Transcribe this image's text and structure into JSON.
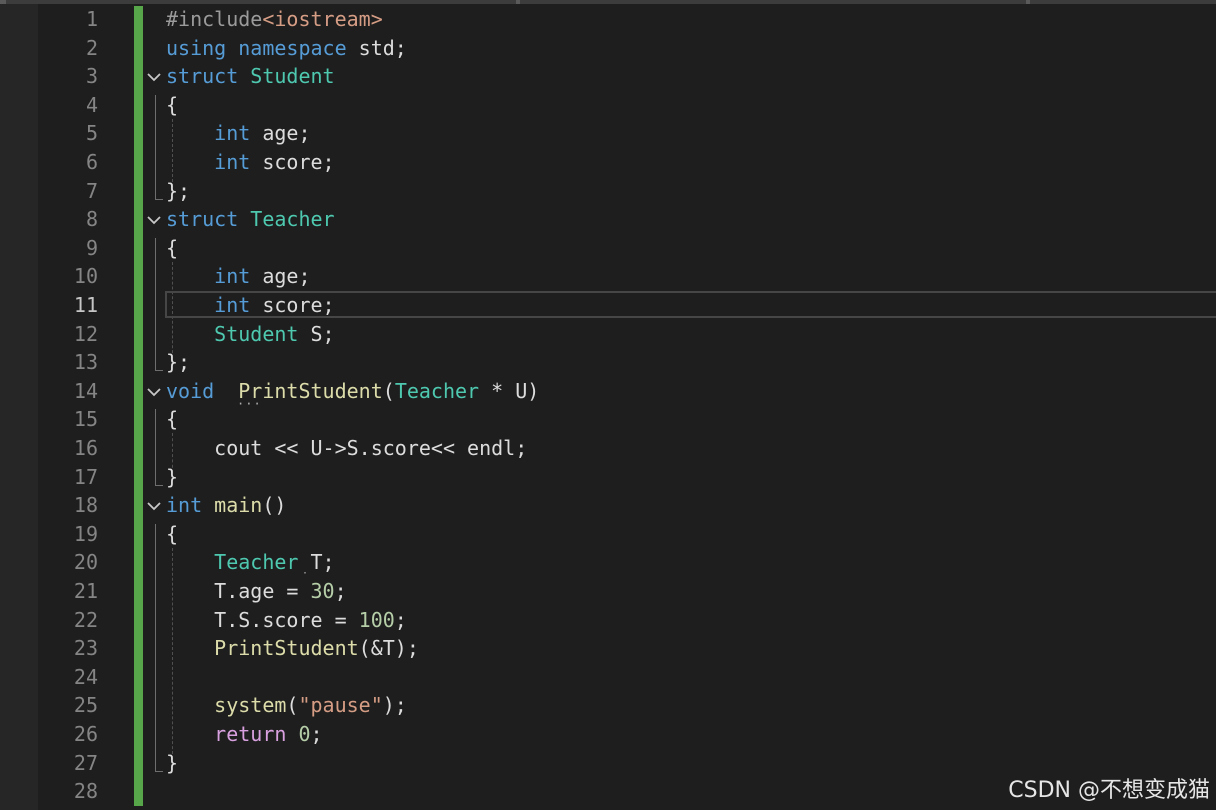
{
  "line_numbers": [
    "1",
    "2",
    "3",
    "4",
    "5",
    "6",
    "7",
    "8",
    "9",
    "10",
    "11",
    "12",
    "13",
    "14",
    "15",
    "16",
    "17",
    "18",
    "19",
    "20",
    "21",
    "22",
    "23",
    "24",
    "25",
    "26",
    "27",
    "28"
  ],
  "current_line": "11",
  "code_lines": [
    [
      {
        "t": "#include",
        "c": "pre"
      },
      {
        "t": "<iostream>",
        "c": "str"
      }
    ],
    [
      {
        "t": "using",
        "c": "kw"
      },
      {
        "t": " "
      },
      {
        "t": "namespace",
        "c": "kw"
      },
      {
        "t": " std;"
      }
    ],
    [
      {
        "t": "struct",
        "c": "kw"
      },
      {
        "t": " "
      },
      {
        "t": "Student",
        "c": "type"
      }
    ],
    [
      {
        "t": "{"
      }
    ],
    [
      {
        "t": "    "
      },
      {
        "t": "int",
        "c": "kw"
      },
      {
        "t": " age;"
      }
    ],
    [
      {
        "t": "    "
      },
      {
        "t": "int",
        "c": "kw"
      },
      {
        "t": " score;"
      }
    ],
    [
      {
        "t": "};"
      }
    ],
    [
      {
        "t": "struct",
        "c": "kw"
      },
      {
        "t": " "
      },
      {
        "t": "Teacher",
        "c": "type"
      }
    ],
    [
      {
        "t": "{"
      }
    ],
    [
      {
        "t": "    "
      },
      {
        "t": "int",
        "c": "kw"
      },
      {
        "t": " age;"
      }
    ],
    [
      {
        "t": "    "
      },
      {
        "t": "int",
        "c": "kw"
      },
      {
        "t": " score;"
      }
    ],
    [
      {
        "t": "    "
      },
      {
        "t": "Student",
        "c": "type"
      },
      {
        "t": " S;"
      }
    ],
    [
      {
        "t": "};"
      }
    ],
    [
      {
        "t": "void",
        "c": "kw"
      },
      {
        "t": "  "
      },
      {
        "t": "PrintStudent",
        "c": "fn"
      },
      {
        "t": "("
      },
      {
        "t": "Teacher",
        "c": "type"
      },
      {
        "t": " * U)"
      }
    ],
    [
      {
        "t": "{"
      }
    ],
    [
      {
        "t": "    cout << U->S.score<< endl;"
      }
    ],
    [
      {
        "t": "}"
      }
    ],
    [
      {
        "t": "int",
        "c": "kw"
      },
      {
        "t": " "
      },
      {
        "t": "main",
        "c": "fn"
      },
      {
        "t": "()"
      }
    ],
    [
      {
        "t": "{"
      }
    ],
    [
      {
        "t": "    "
      },
      {
        "t": "Teacher",
        "c": "type"
      },
      {
        "t": " T;"
      }
    ],
    [
      {
        "t": "    T.age = "
      },
      {
        "t": "30",
        "c": "num"
      },
      {
        "t": ";"
      }
    ],
    [
      {
        "t": "    T.S.score = "
      },
      {
        "t": "100",
        "c": "num"
      },
      {
        "t": ";"
      }
    ],
    [
      {
        "t": "    "
      },
      {
        "t": "PrintStudent",
        "c": "fn"
      },
      {
        "t": "(&T);"
      }
    ],
    [],
    [
      {
        "t": "    "
      },
      {
        "t": "system",
        "c": "fn"
      },
      {
        "t": "("
      },
      {
        "t": "\"pause\"",
        "c": "str"
      },
      {
        "t": ");"
      }
    ],
    [
      {
        "t": "    "
      },
      {
        "t": "return",
        "c": "kw2"
      },
      {
        "t": " "
      },
      {
        "t": "0",
        "c": "num"
      },
      {
        "t": ";"
      }
    ],
    [
      {
        "t": "}"
      }
    ],
    []
  ],
  "fold_lines": [
    "3",
    "8",
    "14",
    "18"
  ],
  "watermark": "CSDN @不想变成猫",
  "colors": {
    "background": "#1e1e1e",
    "line_number": "#858585",
    "change_bar": "#57a64a",
    "keyword": "#569cd6",
    "control_keyword": "#d8a0df",
    "type": "#4ec9b0",
    "function": "#dcdcaa",
    "string": "#d69d85",
    "number": "#b5cea8",
    "preprocessor": "#9b9b9b",
    "text": "#dcdcdc"
  },
  "icons": {
    "fold": "chevron-down-icon"
  }
}
